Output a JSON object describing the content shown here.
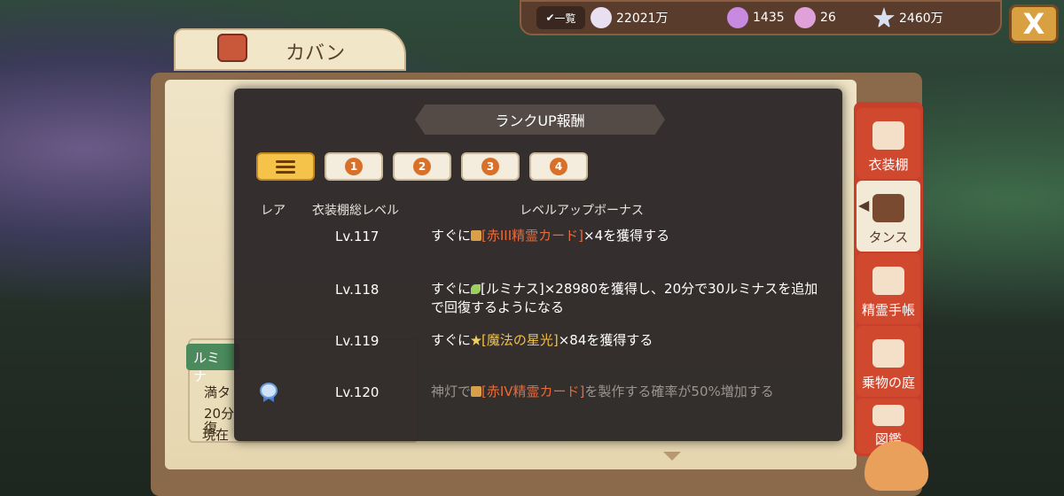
{
  "bag": {
    "title": "カバン"
  },
  "topbar": {
    "list_label": "一覧",
    "currencies": [
      {
        "icon": "shell-icon",
        "value": "22021万"
      },
      {
        "icon": "crystal-icon",
        "value": "1435"
      },
      {
        "icon": "spiral-shell-icon",
        "value": "26"
      },
      {
        "icon": "star-icon",
        "value": "2460万"
      }
    ],
    "close_label": "X"
  },
  "sidebar": {
    "items": [
      {
        "label": "衣装棚",
        "icon": "jacket-icon"
      },
      {
        "label": "タンス",
        "icon": "wardrobe-icon"
      },
      {
        "label": "精霊手帳",
        "icon": "notebook-icon"
      },
      {
        "label": "乗物の庭",
        "icon": "carriage-icon"
      },
      {
        "label": "図鑑",
        "icon": "scroll-icon"
      }
    ]
  },
  "leftpanel": {
    "tab": "ルミナ",
    "line1": "満タ",
    "line2": "20分",
    "line3": "復",
    "line4": "現在"
  },
  "modal": {
    "title": "ランクUP報酬",
    "tabs": [
      "1",
      "2",
      "3",
      "4"
    ],
    "headers": {
      "rare": "レア",
      "level": "衣装棚総レベル",
      "bonus": "レベルアップボーナス"
    },
    "rows": [
      {
        "level": "Lv.117",
        "pre": "すぐに",
        "item": "[赤III精霊カード]",
        "post": "×4を獲得する"
      },
      {
        "level": "Lv.118",
        "pre": "すぐに",
        "item": "[ルミナス]",
        "post": "×28980を獲得し、20分で30ルミナスを追加で回復するようになる"
      },
      {
        "level": "Lv.119",
        "pre": "すぐに",
        "item": "[魔法の星光]",
        "post": "×84を獲得する"
      },
      {
        "level": "Lv.120",
        "pre": "神灯で",
        "item": "[赤IV精霊カード]",
        "post": "を製作する確率が50%増加する"
      }
    ]
  },
  "colors": {
    "accent": "#f6c34a",
    "sidebar": "#c8402c",
    "highlight_red": "#e86a3a",
    "highlight_gold": "#f2c040"
  }
}
